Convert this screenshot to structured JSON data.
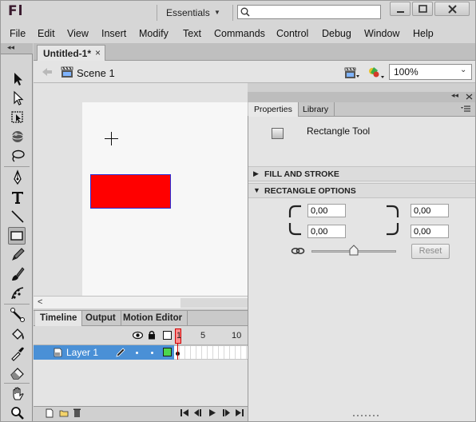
{
  "app": {
    "logo": "Fl",
    "workspace": "Essentials",
    "workspace_caret": "▼"
  },
  "search": {
    "placeholder": "",
    "value": ""
  },
  "window_controls": {
    "minimize": "minimize",
    "maximize": "maximize",
    "close": "close"
  },
  "menu": [
    "File",
    "Edit",
    "View",
    "Insert",
    "Modify",
    "Text",
    "Commands",
    "Control",
    "Debug",
    "Window",
    "Help"
  ],
  "tools_header": "◂◂",
  "document": {
    "tab_label": "Untitled-1*",
    "tab_close": "×"
  },
  "editbar": {
    "scene_label": "Scene 1",
    "zoom": "100%",
    "zoom_caret": "⌄"
  },
  "stage": {
    "shape_fill": "#ff0000",
    "shape_stroke": "#2b2bd6",
    "stage_color": "#f7f7f7"
  },
  "scroll": {
    "left_arrow": "<"
  },
  "timeline": {
    "tabs": [
      "Timeline",
      "Output",
      "Motion Editor"
    ],
    "frame_numbers": [
      "1",
      "5",
      "10"
    ],
    "layer": {
      "name": "Layer 1",
      "color": "#4cd64c"
    }
  },
  "properties": {
    "collapse": "◂◂",
    "tabs": [
      "Properties",
      "Library"
    ],
    "tool_name": "Rectangle Tool",
    "sections": [
      {
        "label": "FILL AND STROKE",
        "expanded": false,
        "arrow": "▶"
      },
      {
        "label": "RECTANGLE OPTIONS",
        "expanded": true,
        "arrow": "▼"
      }
    ],
    "corners": {
      "top_left": "0,00",
      "top_right": "0,00",
      "bottom_left": "0,00",
      "bottom_right": "0,00"
    },
    "reset_label": "Reset"
  },
  "colors": {
    "accent": "#4a90d6",
    "chrome": "#d6d6d6",
    "playhead": "#d40000"
  }
}
